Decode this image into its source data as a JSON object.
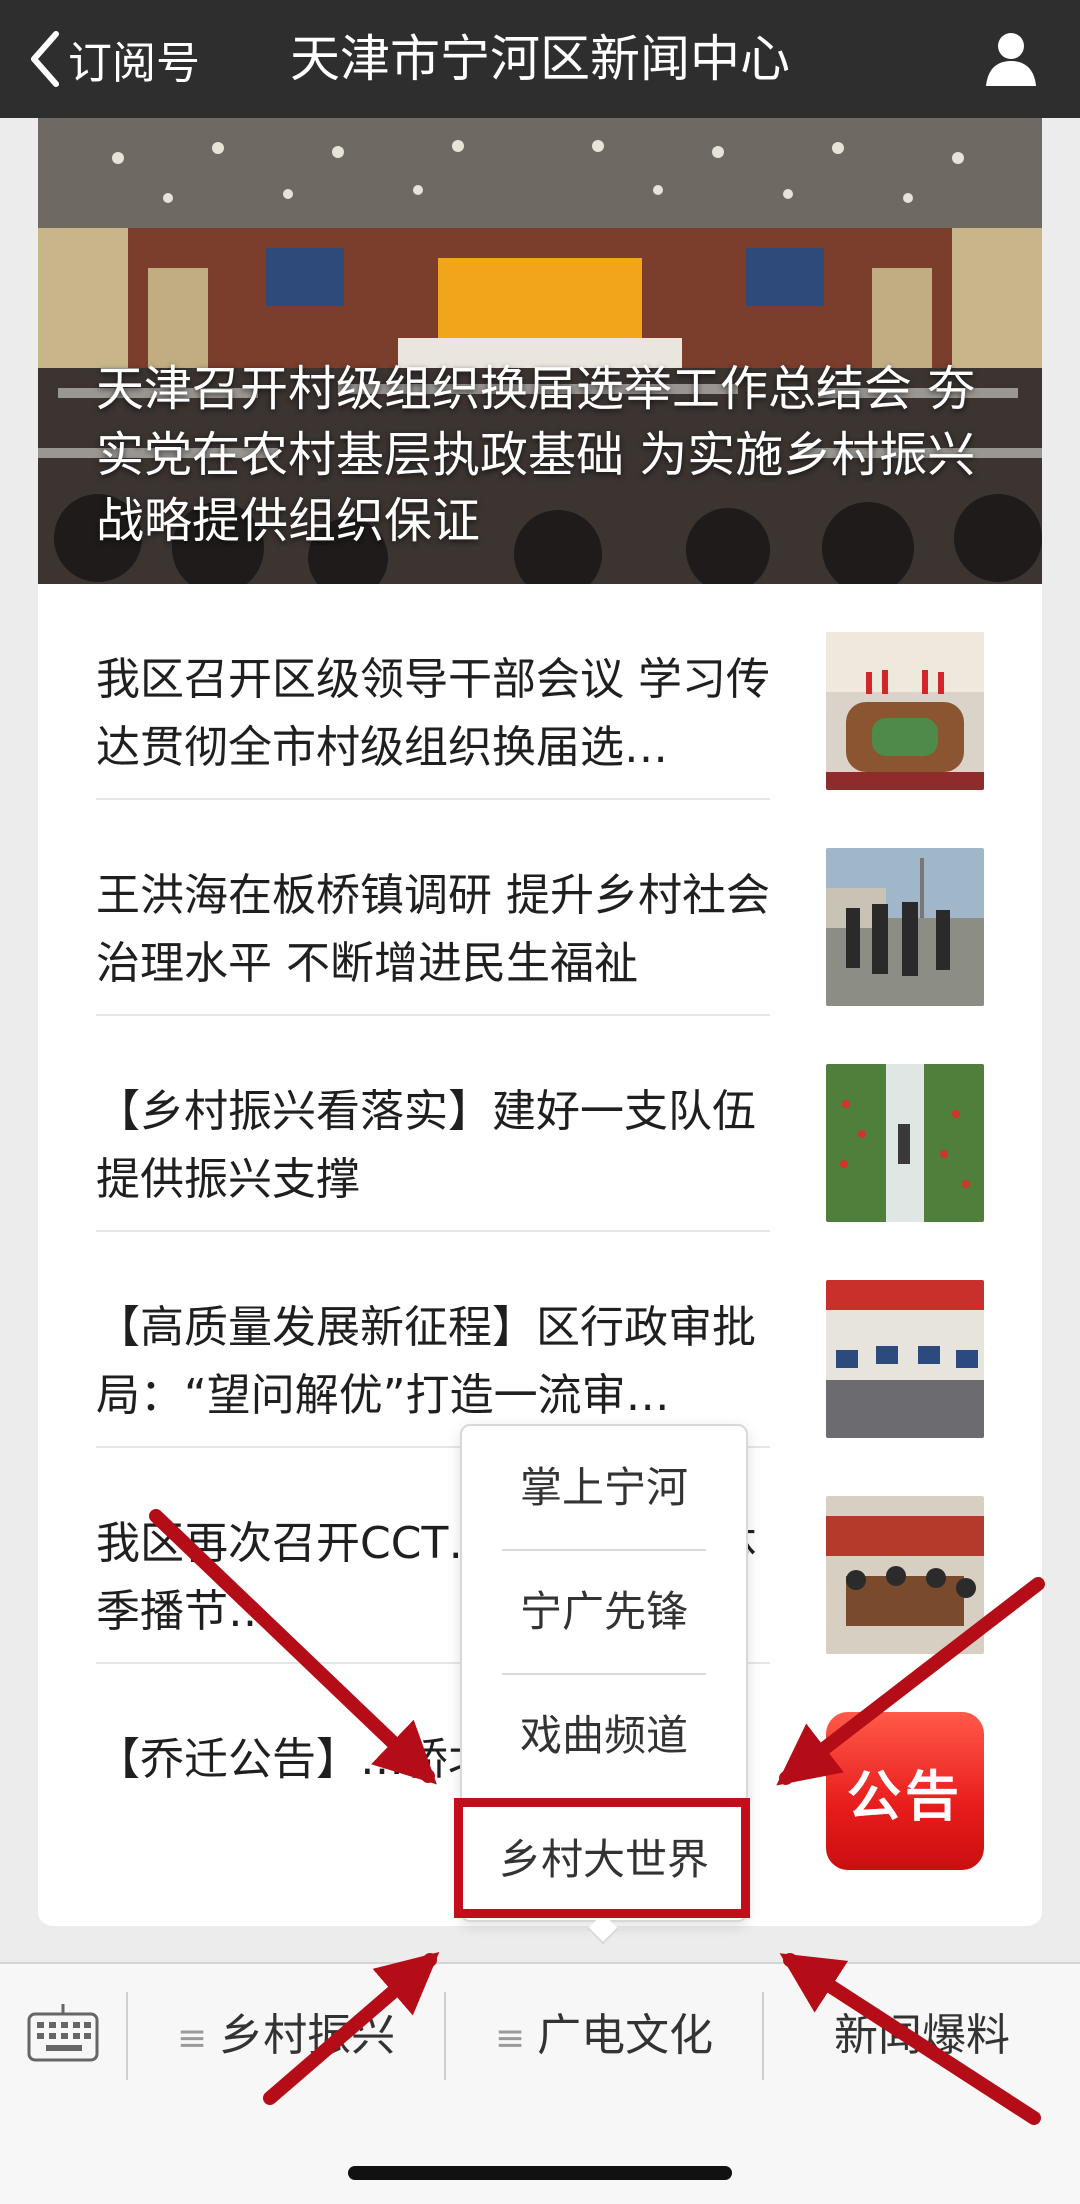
{
  "topbar": {
    "back_label": "订阅号",
    "title": "天津市宁河区新闻中心",
    "colors": {
      "background": "#2e2e2e",
      "text": "#ffffff"
    }
  },
  "hero": {
    "caption": "天津召开村级组织换届选举工作总结会 夯实党在农村基层执政基础 为实施乡村振兴战略提供组织保证"
  },
  "news": [
    {
      "title": "我区召开区级领导干部会议 学习传达贯彻全市村级组织换届选…"
    },
    {
      "title": "王洪海在板桥镇调研 提升乡村社会治理水平 不断增进民生福祉"
    },
    {
      "title": "【乡村振兴看落实】建好一支队伍 提供振兴支撑"
    },
    {
      "title": "【高质量发展新征程】区行政审批局：“望问解优”打造一流审…"
    },
    {
      "title": "我区再次召开CCT…世界》全媒体季播节…"
    },
    {
      "title": "【乔迁公告】…桥北新区",
      "badge": "公告"
    }
  ],
  "popup": {
    "items": [
      "掌上宁河",
      "宁广先锋",
      "戏曲频道",
      "乡村大世界"
    ],
    "highlighted_index": 3,
    "highlight_color": "#c20d1a"
  },
  "bottom_menu": {
    "items": [
      {
        "label": "乡村振兴",
        "icon": "menu-lines-icon"
      },
      {
        "label": "广电文化",
        "icon": "menu-lines-icon"
      },
      {
        "label": "新闻爆料"
      }
    ]
  }
}
